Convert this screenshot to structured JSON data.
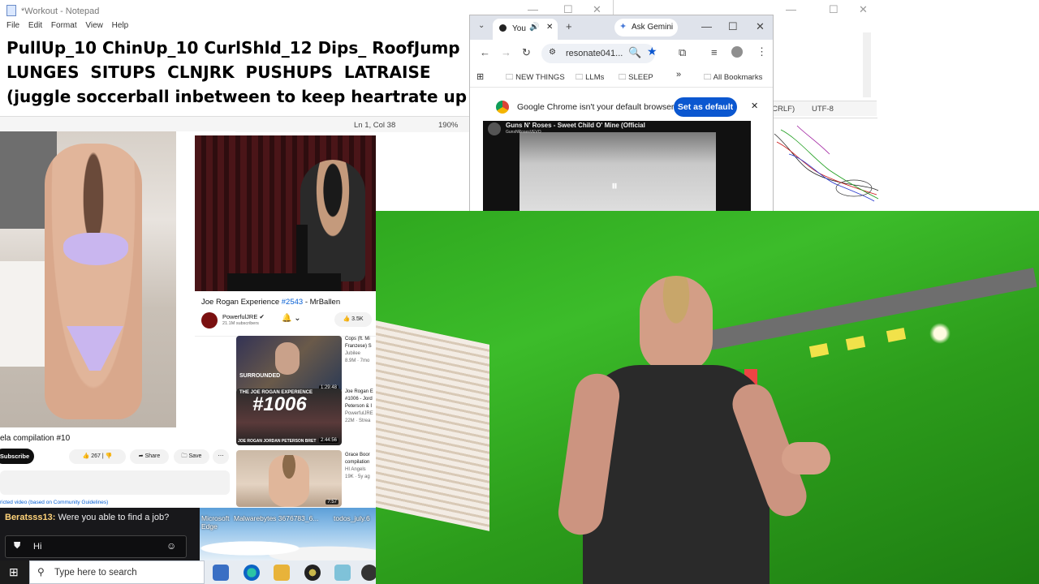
{
  "notepad": {
    "title": "*Workout - Notepad",
    "menu": [
      "File",
      "Edit",
      "Format",
      "View",
      "Help"
    ],
    "lines": [
      "PullUp_10 ChinUp_10 CurlShld_12 Dips_ RoofJump",
      "LUNGES  SITUPS  CLNJRK  PUSHUPS  LATRAISE",
      "(juggle soccerball inbetween to keep heartrate up"
    ],
    "status": {
      "position": "Ln 1, Col 38",
      "zoom": "190%"
    }
  },
  "notepad_back": {
    "status": {
      "line_ending": "(CRLF)",
      "encoding": "UTF-8"
    }
  },
  "chrome": {
    "tab_label": "You",
    "gemini_label": "Ask Gemini",
    "url": "resonate041...",
    "bookmarks": [
      "NEW THINGS",
      "LLMs",
      "SLEEP"
    ],
    "more_bookmarks": "»",
    "all_bookmarks": "All Bookmarks",
    "infobar_text": "Google Chrome isn't your default browser",
    "set_default_label": "Set as default",
    "video_title": "Guns N' Roses - Sweet Child O' Mine (Official",
    "video_channel": "GunsNRosesVEVO"
  },
  "bikini_video": {
    "title": "ela compilation #10",
    "subscribe_label": "Subscribe",
    "likes": "267",
    "share_label": "Share",
    "save_label": "Save",
    "restricted_note": "ricted video (based on Community Guidelines)"
  },
  "jre_video": {
    "title_prefix": "Joe Rogan Experience ",
    "episode": "#2543",
    "title_suffix": " - MrBallen",
    "channel": "PowerfulJRE",
    "subscribers": "21.1M subscribers",
    "likes": "3.5K"
  },
  "related": [
    {
      "title": "Cops (ft. Mi Franzese) S",
      "channel": "Jubilee",
      "meta": "8.9M · 7mo",
      "duration": "1:29:48",
      "overlay": "SURROUNDED"
    },
    {
      "title": "Joe Rogan E #1006 - Jord Peterson & I",
      "channel": "PowerfulJRE",
      "meta": "22M · Strea",
      "duration": "2:44:56",
      "overlay": "#1006",
      "overlay_top": "THE JOE ROGAN EXPERIENCE",
      "overlay_bottom": "JOE ROGAN JORDAN PETERSON BRET"
    },
    {
      "title": "Grace Boor compilation",
      "channel": "HI Angels",
      "meta": "19K · 5y ag",
      "duration": "7:57"
    }
  ],
  "chat": {
    "username": "Beratsss13:",
    "message": "Were you able to find a job?",
    "input_value": "Hi"
  },
  "desktop": {
    "icons": [
      "Microsoft Edge",
      "Malwarebytes 3676783_6...",
      "todos_july.6"
    ]
  },
  "taskbar": {
    "search_placeholder": "Type here to search"
  },
  "colors": {
    "chrome_blue": "#0b57d0",
    "webcam_green": "#35b324",
    "chat_bg": "#18181b",
    "jre_episode": "#065fd4"
  }
}
